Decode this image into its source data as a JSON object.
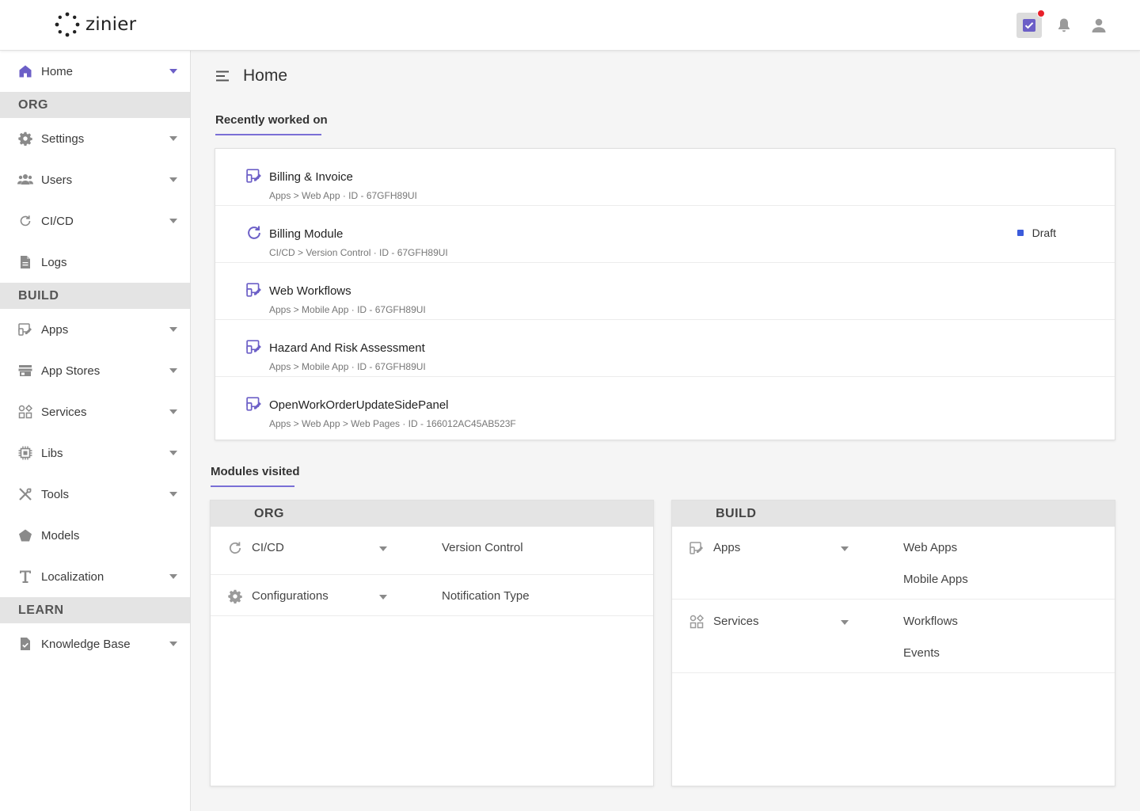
{
  "app": {
    "logo_text": "zinier"
  },
  "colors": {
    "accent": "#6c5fc7",
    "draft": "#3b5bdb",
    "notification_dot": "#e8202a"
  },
  "topbar": {
    "icons": [
      "tasks-icon",
      "bell-icon",
      "user-icon"
    ]
  },
  "sidebar": {
    "home": {
      "label": "Home",
      "icon": "home-icon"
    },
    "sections": [
      {
        "title": "ORG",
        "items": [
          {
            "label": "Settings",
            "icon": "gear-icon",
            "expandable": true
          },
          {
            "label": "Users",
            "icon": "users-icon",
            "expandable": true
          },
          {
            "label": "CI/CD",
            "icon": "refresh-icon",
            "expandable": true
          },
          {
            "label": "Logs",
            "icon": "document-icon",
            "expandable": false
          }
        ]
      },
      {
        "title": "BUILD",
        "items": [
          {
            "label": "Apps",
            "icon": "app-icon",
            "expandable": true
          },
          {
            "label": "App Stores",
            "icon": "store-icon",
            "expandable": true
          },
          {
            "label": "Services",
            "icon": "services-icon",
            "expandable": true
          },
          {
            "label": "Libs",
            "icon": "chip-icon",
            "expandable": true
          },
          {
            "label": "Tools",
            "icon": "tools-icon",
            "expandable": true
          },
          {
            "label": "Models",
            "icon": "pentagon-icon",
            "expandable": false
          },
          {
            "label": "Localization",
            "icon": "text-icon",
            "expandable": true
          }
        ]
      },
      {
        "title": "LEARN",
        "items": [
          {
            "label": "Knowledge Base",
            "icon": "book-icon",
            "expandable": true
          }
        ]
      }
    ]
  },
  "main": {
    "title": "Home",
    "recent_tab": "Recently worked on",
    "recent": [
      {
        "title": "Billing & Invoice",
        "sub": "Apps > Web App · ID - 67GFH89UI",
        "icon": "app-icon",
        "status": ""
      },
      {
        "title": "Billing Module",
        "sub": "CI/CD > Version Control · ID - 67GFH89UI",
        "icon": "refresh-icon",
        "status": "Draft"
      },
      {
        "title": "Web Workflows",
        "sub": "Apps > Mobile App · ID - 67GFH89UI",
        "icon": "app-icon",
        "status": ""
      },
      {
        "title": "Hazard And Risk Assessment",
        "sub": "Apps > Mobile App · ID - 67GFH89UI",
        "icon": "app-icon",
        "status": ""
      },
      {
        "title": "OpenWorkOrderUpdateSidePanel",
        "sub": "Apps > Web App > Web Pages · ID - 166012AC45AB523F",
        "icon": "app-icon",
        "status": ""
      }
    ],
    "modules_tab": "Modules visited",
    "modules": {
      "org": {
        "title": "ORG",
        "rows": [
          {
            "label": "CI/CD",
            "icon": "refresh-icon",
            "subs": [
              "Version Control"
            ]
          },
          {
            "label": "Configurations",
            "icon": "gear-icon",
            "subs": [
              "Notification Type"
            ]
          }
        ]
      },
      "build": {
        "title": "BUILD",
        "rows": [
          {
            "label": "Apps",
            "icon": "app-icon",
            "subs": [
              "Web Apps",
              "Mobile Apps"
            ]
          },
          {
            "label": "Services",
            "icon": "services-icon",
            "subs": [
              "Workflows",
              "Events"
            ]
          }
        ]
      }
    }
  }
}
